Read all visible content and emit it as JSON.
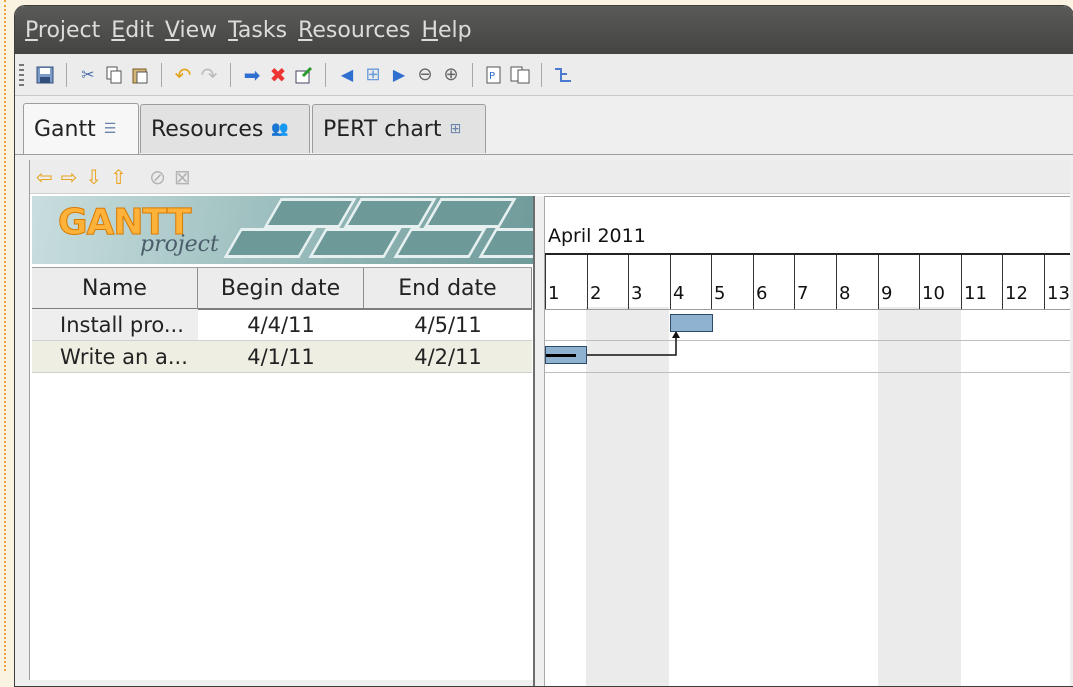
{
  "menu": [
    {
      "u": "P",
      "rest": "roject"
    },
    {
      "u": "E",
      "rest": "dit"
    },
    {
      "u": "V",
      "rest": "iew"
    },
    {
      "u": "T",
      "rest": "asks"
    },
    {
      "u": "R",
      "rest": "esources"
    },
    {
      "u": "H",
      "rest": "elp"
    }
  ],
  "tabs": {
    "gantt": "Gantt",
    "resources": "Resources",
    "pert": "PERT chart"
  },
  "logo": {
    "title": "GANTT",
    "subtitle": "project"
  },
  "table": {
    "headers": {
      "name": "Name",
      "begin": "Begin date",
      "end": "End date"
    },
    "rows": [
      {
        "name": "Install pro...",
        "begin": "4/4/11",
        "end": "4/5/11"
      },
      {
        "name": "Write an a...",
        "begin": "4/1/11",
        "end": "4/2/11"
      }
    ]
  },
  "chart": {
    "month": "April 2011",
    "days": [
      "1",
      "2",
      "3",
      "4",
      "5",
      "6",
      "7",
      "8",
      "9",
      "10",
      "11",
      "12",
      "13"
    ]
  },
  "colors": {
    "menubar": "#4e4e4c",
    "task_bar": "#8eb2cf",
    "logo_orange": "#ffb23a"
  },
  "icons": [
    "save-icon",
    "cut-icon",
    "copy-icon",
    "paste-icon",
    "undo-icon",
    "redo-icon",
    "indent-icon",
    "delete-icon",
    "properties-icon",
    "scroll-left-icon",
    "zoom-fit-icon",
    "scroll-right-icon",
    "zoom-out-icon",
    "zoom-in-icon",
    "print-preview-icon",
    "import-icon",
    "critical-path-icon"
  ]
}
